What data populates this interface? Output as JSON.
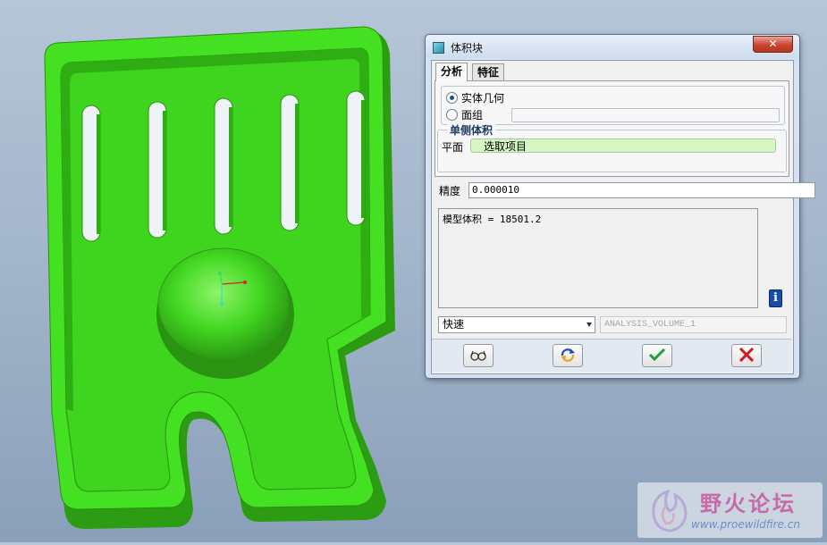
{
  "dialog": {
    "title": "体积块",
    "close_glyph": "✕",
    "tabs": [
      {
        "label": "分析",
        "selected": true
      },
      {
        "label": "特征",
        "selected": false
      }
    ],
    "geometry_options": [
      {
        "label": "实体几何",
        "selected": true
      },
      {
        "label": "面组",
        "selected": false
      }
    ],
    "one_sided_volume": {
      "legend": "单侧体积",
      "plane_label": "平面",
      "select_item": "选取项目"
    },
    "accuracy": {
      "label": "精度",
      "value": "0.000010"
    },
    "result_text": "模型体积 = 18501.2",
    "info_icon": "i",
    "mode_select": {
      "value": "快速"
    },
    "analysis_name": "ANALYSIS_VOLUME_1",
    "buttons": [
      {
        "name": "preview-button",
        "icon": "glasses-icon"
      },
      {
        "name": "repeat-button",
        "icon": "refresh-icon"
      },
      {
        "name": "ok-button",
        "icon": "checkmark-icon"
      },
      {
        "name": "cancel-button",
        "icon": "red-x-icon"
      }
    ]
  },
  "viewport": {
    "model": "green part with slots, raised boss and bottom notch",
    "model_color": "#44e022"
  },
  "watermark": {
    "title": "野火论坛",
    "url": "www.proewildfire.cn"
  },
  "colors": {
    "background_top": "#b6c6d8",
    "model_green": "#44e022",
    "select_field": "#d5f7c4",
    "close_button": "#c8452f",
    "info_icon": "#1a4ba8"
  }
}
